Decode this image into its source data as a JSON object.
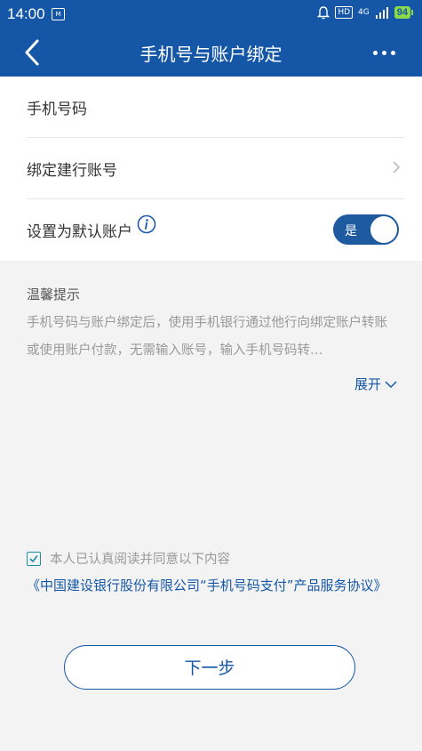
{
  "status_bar": {
    "time": "14:00",
    "notif_label": "M",
    "hd": "HD",
    "network": "4G",
    "battery": "94"
  },
  "nav": {
    "title": "手机号与账户绑定"
  },
  "form": {
    "phone_label": "手机号码",
    "account_label": "绑定建行账号",
    "default_label": "设置为默认账户",
    "toggle_label": "是"
  },
  "tips": {
    "title": "温馨提示",
    "text": "手机号码与账户绑定后，使用手机银行通过他行向绑定账户转账或使用账户付款，无需输入账号，输入手机号码转…",
    "expand_label": "展开"
  },
  "agreement": {
    "agree_text": "本人已认真阅读并同意以下内容",
    "link_text": "《中国建设银行股份有限公司“手机号码支付”产品服务协议》"
  },
  "actions": {
    "next_label": "下一步"
  },
  "colors": {
    "primary": "#1557a6",
    "battery": "#8bd94a"
  }
}
